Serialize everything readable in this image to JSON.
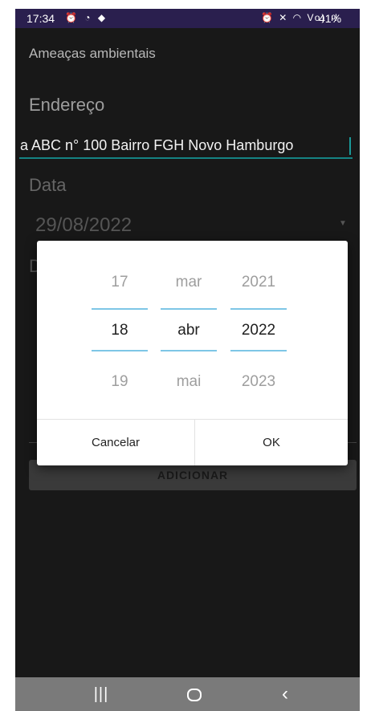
{
  "status_bar": {
    "time": "17:34",
    "left_icons": "⏰ ◔ ◆",
    "right_icons": "⏰ ✕ ◠ Vo) ıl",
    "battery": "41%"
  },
  "app": {
    "title": "Ameaças ambientais",
    "endereco_label": "Endereço",
    "endereco_value": "a ABC n° 100 Bairro FGH Novo Hamburgo",
    "data_label": "Data",
    "data_value": "29/08/2022",
    "desc_label": "D",
    "add_button_label": "ADICIONAR"
  },
  "date_picker": {
    "day": {
      "prev": "17",
      "selected": "18",
      "next": "19"
    },
    "month": {
      "prev": "mar",
      "selected": "abr",
      "next": "mai"
    },
    "year": {
      "prev": "2021",
      "selected": "2022",
      "next": "2023"
    },
    "cancel_label": "Cancelar",
    "ok_label": "OK",
    "accent_color": "#7ec6e6"
  },
  "nav_bar": {
    "recents_icon": "recents-icon",
    "home_icon": "home-icon",
    "back_icon": "back-icon"
  },
  "colors": {
    "status_bar_bg": "#2a1f4e",
    "app_bg": "#181818",
    "input_underline": "#158383"
  }
}
